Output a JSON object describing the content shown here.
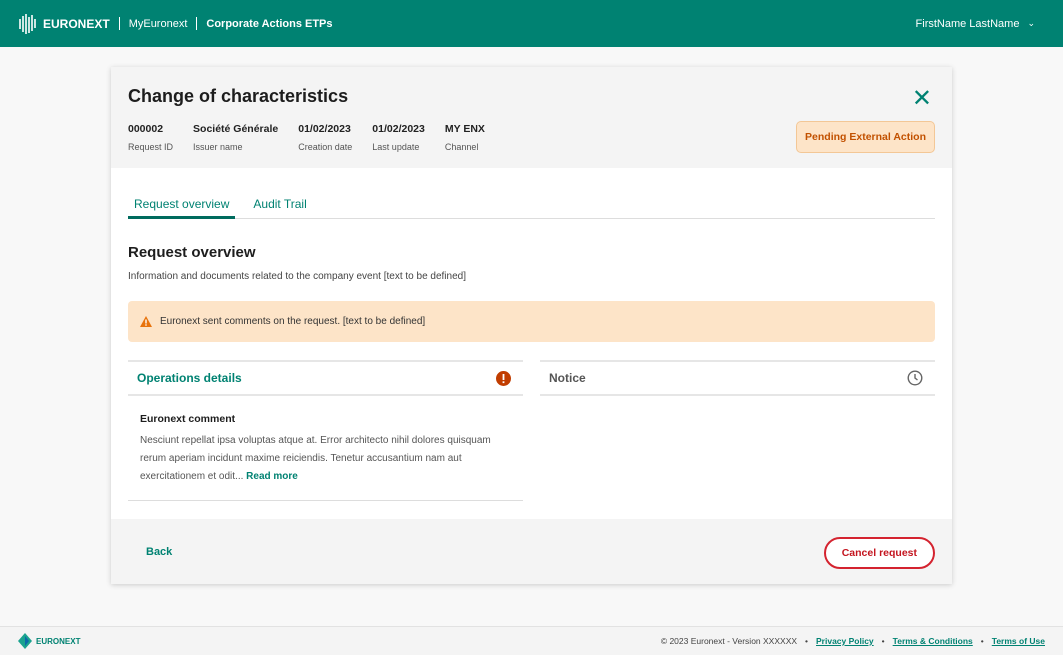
{
  "header": {
    "logo": "EURONEXT",
    "app": "MyEuronext",
    "section": "Corporate Actions ETPs",
    "user": "FirstName LastName"
  },
  "request": {
    "title": "Change of characteristics",
    "status": "Pending External Action",
    "meta": [
      {
        "value": "000002",
        "label": "Request ID"
      },
      {
        "value": "Société Générale",
        "label": "Issuer name"
      },
      {
        "value": "01/02/2023",
        "label": "Creation date"
      },
      {
        "value": "01/02/2023",
        "label": "Last update"
      },
      {
        "value": "MY ENX",
        "label": "Channel"
      }
    ]
  },
  "tabs": [
    "Request overview",
    "Audit Trail"
  ],
  "overview": {
    "title": "Request overview",
    "subtitle": "Information and documents related to the company event [text to be defined]",
    "alert": "Euronext sent comments on the request. [text to be defined]"
  },
  "operations": {
    "title": "Operations details",
    "comment_title": "Euronext comment",
    "comment": "Nesciunt repellat ipsa voluptas atque at. Error architecto nihil dolores quisquam rerum aperiam incidunt maxime reiciendis. Tenetur accusantium nam aut exercitationem et odit...",
    "read_more": "Read more"
  },
  "notice": {
    "title": "Notice"
  },
  "actions": {
    "back": "Back",
    "cancel": "Cancel request"
  },
  "footer": {
    "logo": "EURONEXT",
    "copyright": "© 2023 Euronext - Version XXXXXX",
    "links": [
      "Privacy Policy",
      "Terms & Conditions",
      "Terms of Use"
    ]
  }
}
